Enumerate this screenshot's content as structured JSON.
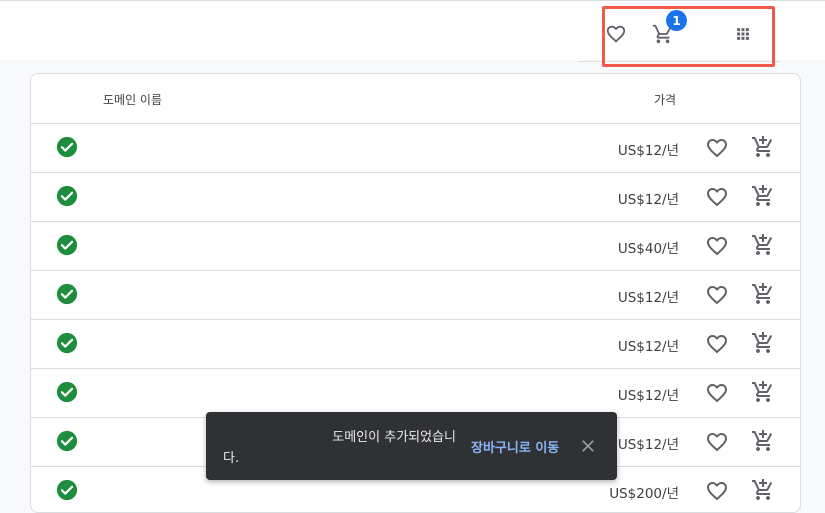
{
  "header": {
    "cart_badge": "1",
    "icons": [
      "favorite-outline-icon",
      "cart-icon",
      "apps-grid-icon"
    ]
  },
  "table": {
    "col_name": "도메인 이름",
    "col_price": "가격",
    "rows": [
      {
        "price": "US$12/년"
      },
      {
        "price": "US$12/년"
      },
      {
        "price": "US$40/년"
      },
      {
        "price": "US$12/년"
      },
      {
        "price": "US$12/년"
      },
      {
        "price": "US$12/년"
      },
      {
        "price": "US$12/년"
      },
      {
        "price": "US$200/년"
      }
    ]
  },
  "toast": {
    "message_line1": "도메인이 추가되었습니",
    "message_line2": "다.",
    "action": "장바구니로 이동"
  },
  "colors": {
    "accent": "#1a73e8",
    "success": "#1e8e3e",
    "highlight": "#f15a4a",
    "toast_bg": "#303134",
    "toast_action": "#8ab4f8"
  }
}
